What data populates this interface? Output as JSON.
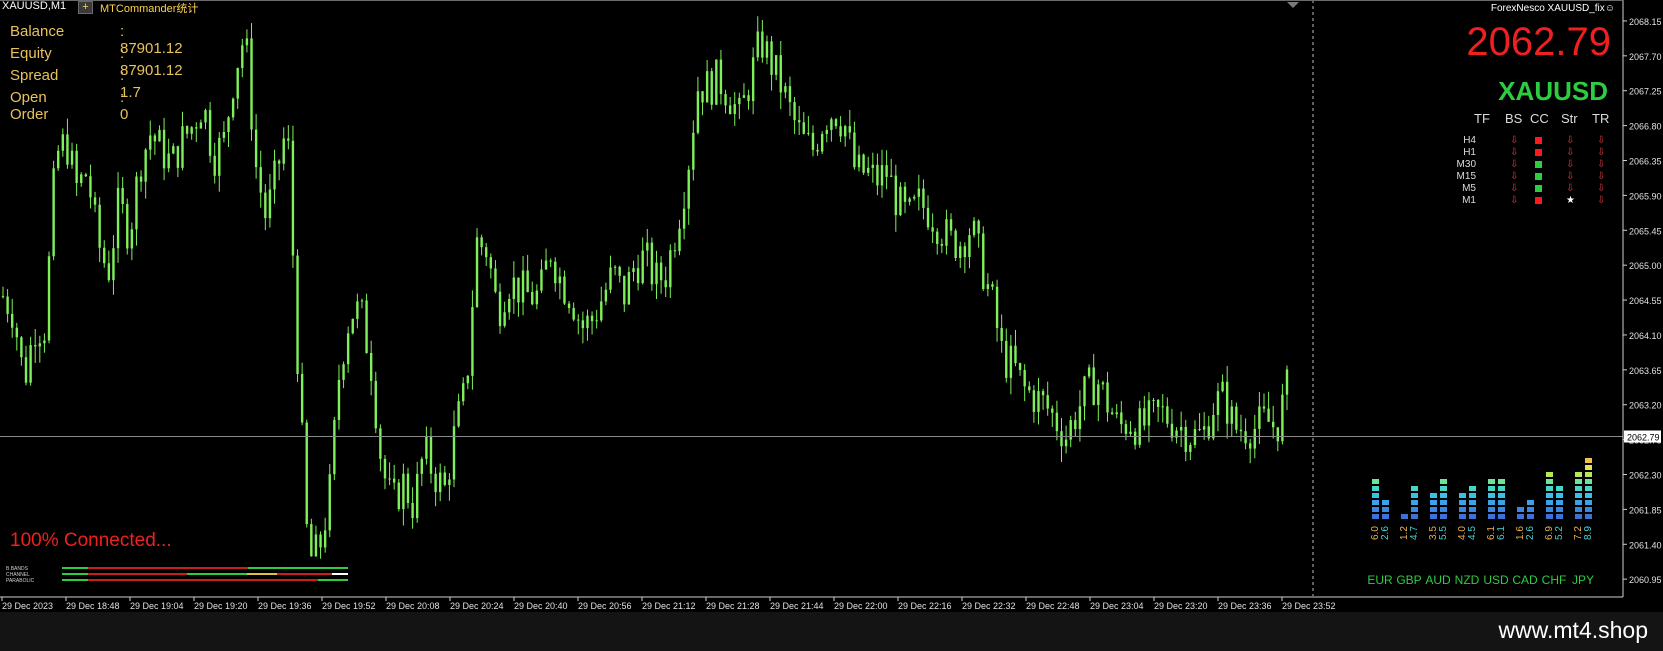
{
  "header": {
    "symbol_tf": "XAUUSD,M1",
    "plus_label": "+",
    "indicator_tab": "MTCommander统计",
    "top_right_label": "ForexNesco XAUUSD_fix☺"
  },
  "account": {
    "rows": [
      {
        "label": "Balance",
        "value": ": 87901.12"
      },
      {
        "label": "Equity",
        "value": ": 87901.12"
      },
      {
        "label": "Spread",
        "value": ": 1.7"
      },
      {
        "label": "Open Order",
        "value": ": 0"
      }
    ]
  },
  "price_panel": {
    "price": "2062.79",
    "symbol": "XAUUSD",
    "price_color": "#ee2020",
    "symbol_color": "#2ecc40"
  },
  "tf_table": {
    "headers": [
      "TF",
      "BS",
      "CC",
      "Str",
      "TR"
    ],
    "rows": [
      {
        "tf": "H4",
        "bs": "⇩",
        "cc": "#ff1a1a",
        "str": "⇩",
        "tr": "⇩"
      },
      {
        "tf": "H1",
        "bs": "⇩",
        "cc": "#ff1a1a",
        "str": "⇩",
        "tr": "⇩"
      },
      {
        "tf": "M30",
        "bs": "⇩",
        "cc": "#2ecc40",
        "str": "⇩",
        "tr": "⇩"
      },
      {
        "tf": "M15",
        "bs": "⇩",
        "cc": "#2ecc40",
        "str": "⇩",
        "tr": "⇩"
      },
      {
        "tf": "M5",
        "bs": "⇩",
        "cc": "#2ecc40",
        "str": "⇩",
        "tr": "⇩"
      },
      {
        "tf": "M1",
        "bs": "⇩",
        "cc": "#ff1a1a",
        "str": "★",
        "tr": "⇩"
      }
    ]
  },
  "connection": {
    "status": "100% Connected...",
    "legend": [
      "B.BANDS",
      "CHANNEL",
      "PARABOLIC"
    ]
  },
  "currency_meter": {
    "currencies": [
      "EUR",
      "GBP",
      "AUD",
      "NZD",
      "USD",
      "CAD",
      "CHF",
      "JPY"
    ],
    "pairs": [
      [
        6.0,
        2.6
      ],
      [
        1.2,
        4.7
      ],
      [
        3.5,
        5.5
      ],
      [
        4.0,
        4.5
      ],
      [
        6.1,
        6.1
      ],
      [
        1.6,
        2.6
      ],
      [
        6.9,
        5.2
      ],
      [
        7.2,
        8.9
      ]
    ],
    "labels": [
      [
        "6.0",
        "2.6"
      ],
      [
        "1.2",
        "4.7"
      ],
      [
        "3.5",
        "5.5"
      ],
      [
        "4.0",
        "4.5"
      ],
      [
        "6.1",
        "6.1"
      ],
      [
        "1.6",
        "2.6"
      ],
      [
        "6.9",
        "5.2"
      ],
      [
        "7.2",
        "8.9"
      ]
    ]
  },
  "watermark": "www.mt4.shop",
  "chart_data": {
    "type": "line",
    "series": [
      {
        "values": [
          2064.6,
          2064.4,
          2063.5,
          2064.2,
          2064.2,
          2066.4,
          2066.6,
          2066.0,
          2066.2,
          2065.3,
          2064.9,
          2065.8,
          2065.4,
          2066.3,
          2066.7,
          2066.5,
          2066.3,
          2066.6,
          2066.8,
          2067.1,
          2066.4,
          2066.6,
          2067.5,
          2068.0,
          2066.3,
          2065.6,
          2066.2,
          2066.8,
          2063.8,
          2061.2,
          2061.3,
          2062.0,
          2063.7,
          2064.4,
          2064.4,
          2063.7,
          2062.4,
          2061.9,
          2062.2,
          2061.9,
          2062.6,
          2062.3,
          2062.1,
          2062.9,
          2063.4,
          2065.3,
          2065.2,
          2064.4,
          2064.8,
          2064.7,
          2064.6,
          2064.6,
          2065.2,
          2064.8,
          2064.6,
          2064.2,
          2064.3,
          2064.6,
          2064.9,
          2064.6,
          2065.0,
          2065.1,
          2064.8,
          2064.9,
          2065.5,
          2066.2,
          2067.3,
          2067.3,
          2067.4,
          2067.2,
          2066.9,
          2067.4,
          2067.9,
          2067.6,
          2067.3,
          2066.9,
          2066.6,
          2066.5,
          2066.9,
          2067.0,
          2066.8,
          2066.2,
          2066.2,
          2066.1,
          2066.2,
          2065.8,
          2065.6,
          2065.8,
          2065.7,
          2065.5,
          2065.3,
          2065.3,
          2065.5,
          2065.0,
          2064.5,
          2063.8,
          2063.7,
          2063.4,
          2063.3,
          2063.2,
          2063.0,
          2062.8,
          2063.1,
          2063.4,
          2063.5,
          2063.2,
          2062.9,
          2063.0,
          2062.9,
          2063.0,
          2063.1,
          2063.0,
          2062.9,
          2062.8,
          2062.8,
          2063.2,
          2063.3,
          2062.9,
          2062.9,
          2062.9,
          2063.0,
          2062.9,
          2063.4
        ]
      }
    ],
    "x_labels": [
      "29 Dec 2023",
      "29 Dec 18:48",
      "29 Dec 19:04",
      "29 Dec 19:20",
      "29 Dec 19:36",
      "29 Dec 19:52",
      "29 Dec 20:08",
      "29 Dec 20:24",
      "29 Dec 20:40",
      "29 Dec 20:56",
      "29 Dec 21:12",
      "29 Dec 21:28",
      "29 Dec 21:44",
      "29 Dec 22:00",
      "29 Dec 22:16",
      "29 Dec 22:32",
      "29 Dec 22:48",
      "29 Dec 23:04",
      "29 Dec 23:20",
      "29 Dec 23:36",
      "29 Dec 23:52"
    ],
    "y_ticks": [
      "2068.15",
      "2067.70",
      "2067.25",
      "2066.80",
      "2066.35",
      "2065.90",
      "2065.45",
      "2065.00",
      "2064.55",
      "2064.10",
      "2063.65",
      "2063.20",
      "2062.75",
      "2062.30",
      "2061.85",
      "2061.40",
      "2060.95"
    ],
    "ylim": [
      2060.72,
      2068.42
    ],
    "current_price_label": "2062.79",
    "current_price": 2062.79,
    "line_color": "#7ef05a",
    "grid": false
  }
}
